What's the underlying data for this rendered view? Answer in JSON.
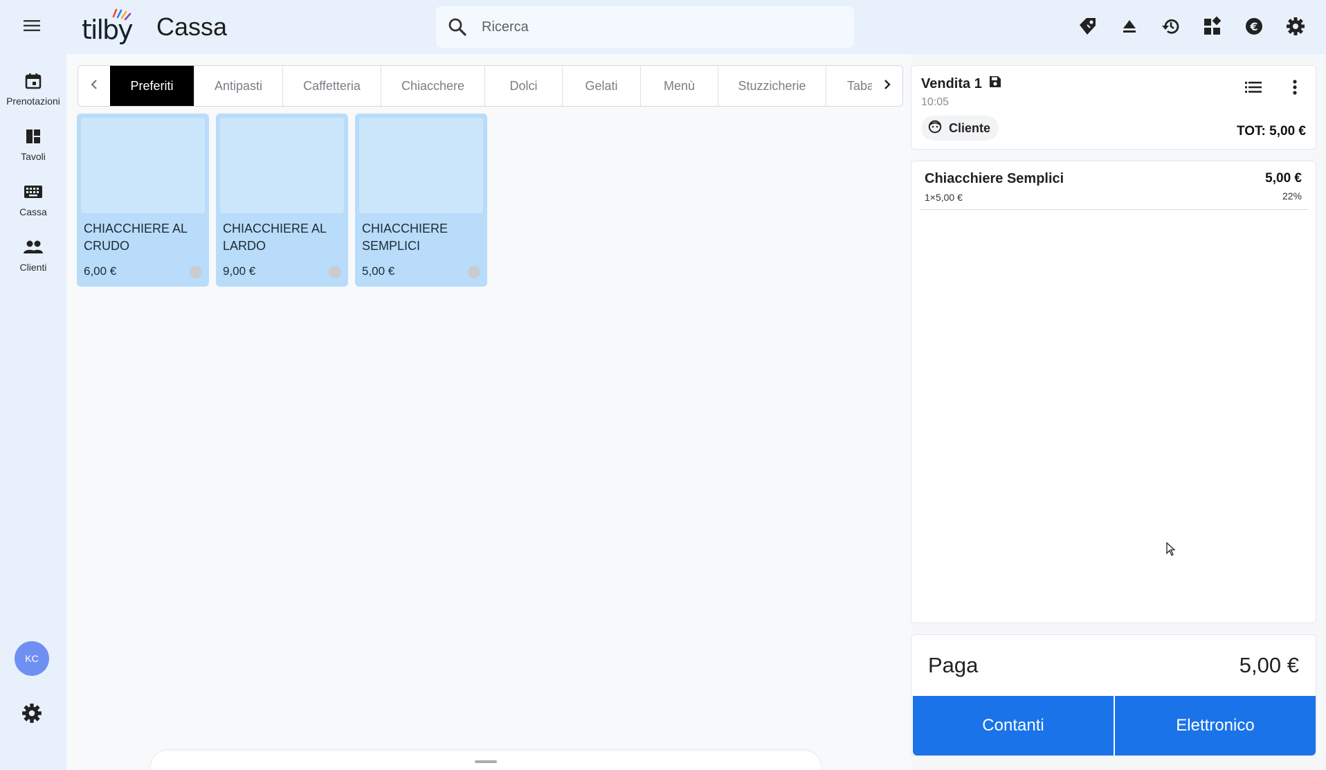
{
  "app": {
    "title": "Cassa"
  },
  "search": {
    "placeholder": "Ricerca"
  },
  "top_icons": [
    "price-tag-icon",
    "eject-icon",
    "history-icon",
    "widgets-icon",
    "euro-icon",
    "settings-icon"
  ],
  "sidebar": {
    "items": [
      {
        "label": "Prenotazioni",
        "icon": "calendar-icon"
      },
      {
        "label": "Tavoli",
        "icon": "tables-icon"
      },
      {
        "label": "Cassa",
        "icon": "keyboard-icon"
      },
      {
        "label": "Clienti",
        "icon": "people-icon"
      }
    ],
    "avatar": "KC"
  },
  "tabs": [
    {
      "label": "Preferiti",
      "active": true
    },
    {
      "label": "Antipasti"
    },
    {
      "label": "Caffetteria"
    },
    {
      "label": "Chiacchere"
    },
    {
      "label": "Dolci"
    },
    {
      "label": "Gelati"
    },
    {
      "label": "Menù"
    },
    {
      "label": "Stuzzicherie"
    },
    {
      "label": "Tabacchi"
    }
  ],
  "products": [
    {
      "name": "CHIACCHIERE AL CRUDO",
      "price": "6,00 €"
    },
    {
      "name": "CHIACCHIERE AL LARDO",
      "price": "9,00 €"
    },
    {
      "name": "CHIACCHIERE SEMPLICI",
      "price": "5,00 €"
    }
  ],
  "sale": {
    "title": "Vendita 1",
    "time": "10:05",
    "customer_label": "Cliente",
    "total": "TOT: 5,00 €",
    "items": [
      {
        "name": "Chiacchiere Semplici",
        "qty": "1×5,00 €",
        "total": "5,00 €",
        "vat": "22%"
      }
    ]
  },
  "payment": {
    "label": "Paga",
    "amount": "5,00 €",
    "cash_label": "Contanti",
    "electronic_label": "Elettronico"
  },
  "colors": {
    "accent": "#1a73e8",
    "background": "#e8f1fb",
    "card": "#b8dcfa",
    "active_tab": "#000000"
  }
}
